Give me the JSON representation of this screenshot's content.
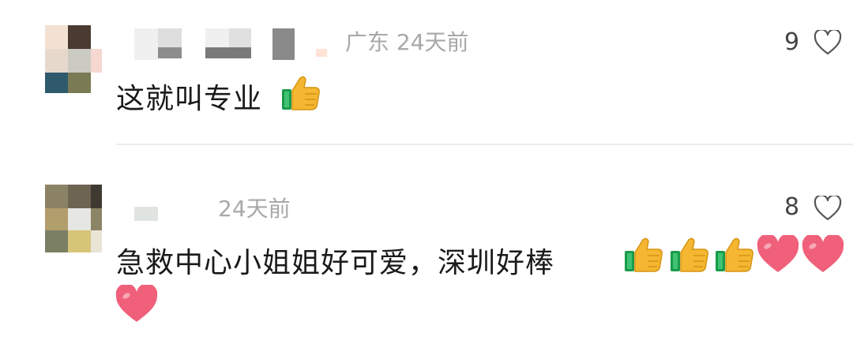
{
  "comments": [
    {
      "meta": "广东 24天前",
      "text": "这就叫专业",
      "likes": "9",
      "reactions": [
        "thumbs-up-icon"
      ]
    },
    {
      "meta": "24天前",
      "text": "急救中心小姐姐好可爱，深圳好棒",
      "likes": "8",
      "reactions": [
        "thumbs-up-icon",
        "thumbs-up-icon",
        "thumbs-up-icon",
        "heart-icon",
        "heart-icon",
        "heart-icon"
      ]
    }
  ],
  "colors": {
    "meta_text": "#a8a8a8",
    "body_text": "#1a1a1a",
    "heart_emoji": "#f0607a",
    "thumb_emoji": "#f5b731"
  }
}
